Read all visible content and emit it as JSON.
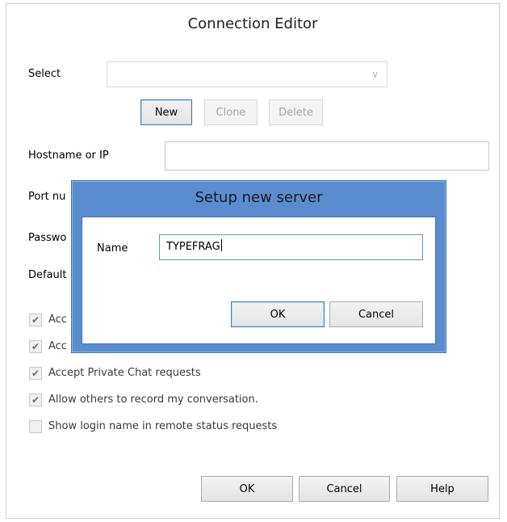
{
  "window": {
    "title": "Connection Editor"
  },
  "form": {
    "select_label": "Select",
    "select_value": "",
    "select_chevron": "∨",
    "new_label": "New",
    "clone_label": "Clone",
    "delete_label": "Delete",
    "hostname_label": "Hostname or IP",
    "hostname_value": "",
    "port_label": "Port nu",
    "password_label": "Passwo",
    "default_label": "Default",
    "checkboxes": [
      {
        "label": "Acc",
        "checked": true,
        "enabled": true
      },
      {
        "label": "Acc",
        "checked": true,
        "enabled": true
      },
      {
        "label": "Accept Private Chat requests",
        "checked": true,
        "enabled": true
      },
      {
        "label": "Allow others to record my conversation.",
        "checked": true,
        "enabled": true
      },
      {
        "label": "Show login name in remote status requests",
        "checked": false,
        "enabled": true
      }
    ]
  },
  "footer": {
    "ok_label": "OK",
    "cancel_label": "Cancel",
    "help_label": "Help"
  },
  "dialog": {
    "title": "Setup new server",
    "name_label": "Name",
    "name_value": "TYPEFRAG",
    "ok_label": "OK",
    "cancel_label": "Cancel"
  },
  "colors": {
    "dialog_frame": "#5a8dd0",
    "focus_border": "#5b9bd5"
  },
  "icons": {
    "checkmark": "check-icon"
  }
}
